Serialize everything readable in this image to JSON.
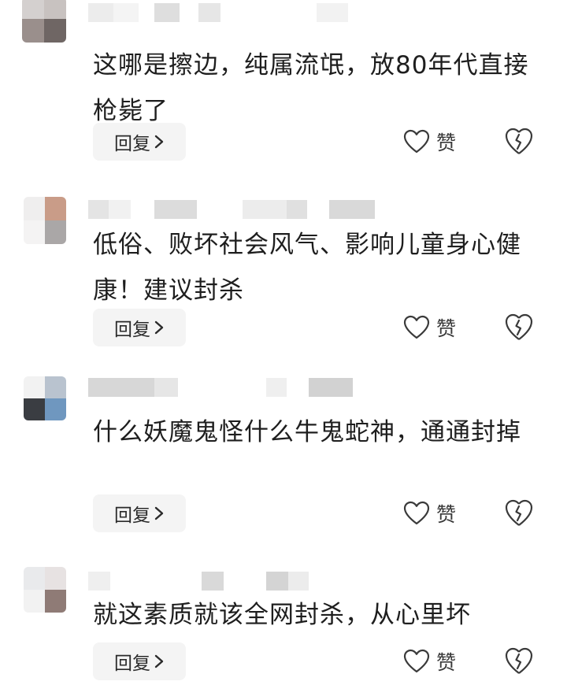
{
  "comments": [
    {
      "text": "这哪是擦边，纯属流氓，放80年代直接枪毙了",
      "reply_label": "回复",
      "like_label": "赞"
    },
    {
      "text": "低俗、败坏社会风气、影响儿童身心健康！建议封杀",
      "reply_label": "回复",
      "like_label": "赞"
    },
    {
      "text": "什么妖魔鬼怪什么牛鬼蛇神，通通封掉",
      "reply_label": "回复",
      "like_label": "赞"
    },
    {
      "text": "就这素质就该全网封杀，从心里坏",
      "reply_label": "回复",
      "like_label": "赞"
    }
  ],
  "icons": {
    "reply_chevron": "chevron-right-icon",
    "like": "heart-outline-icon",
    "dislike": "broken-heart-icon"
  },
  "colors": {
    "text": "#1e1e1e",
    "reply_bg": "#f4f4f4",
    "icon": "#3a3a3a"
  }
}
